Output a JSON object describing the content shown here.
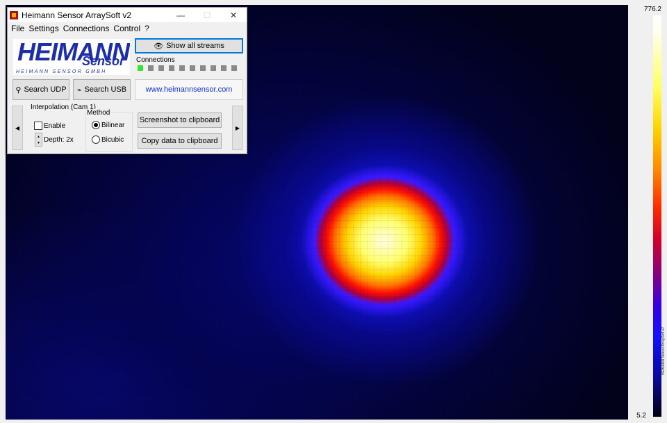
{
  "window": {
    "title": "Heimann Sensor ArraySoft v2",
    "controls": {
      "minimize": "—",
      "maximize": "☐",
      "close": "✕"
    }
  },
  "menu": [
    "File",
    "Settings",
    "Connections",
    "Control",
    "?"
  ],
  "logo": {
    "main": "HEIMANN",
    "sub": "Sensor",
    "foot": "HEIMANN SENSOR GMBH"
  },
  "buttons": {
    "show_streams": "Show all streams",
    "search_udp": "Search UDP",
    "search_usb": "Search USB",
    "website": "www.heimannsensor.com",
    "screenshot": "Screenshot to clipboard",
    "copy_data": "Copy data to clipboard"
  },
  "connections": {
    "label": "Connections",
    "states": [
      true,
      false,
      false,
      false,
      false,
      false,
      false,
      false,
      false,
      false
    ]
  },
  "interpolation": {
    "group_label": "Interpolation (Cam 1)",
    "enable_label": "Enable",
    "enable_checked": false,
    "depth_label": "Depth: 2x",
    "method_label": "Method",
    "methods": [
      {
        "label": "Bilinear",
        "selected": true
      },
      {
        "label": "Bicubic",
        "selected": false
      }
    ]
  },
  "nav": {
    "prev": "◀",
    "next": "▶"
  },
  "scale": {
    "max": "776.2",
    "min": "5.2",
    "vertical_caption": "HEIMANN Sensor ArraySoft v2"
  },
  "icons": {
    "eye": "eye-icon",
    "search": "search-icon",
    "usb": "usb-icon",
    "arrow_up": "arrow-up-icon",
    "arrow_down": "arrow-down-icon"
  },
  "colors": {
    "accent": "#0078d7",
    "logo": "#1d2ea8",
    "connected": "#2ee82e",
    "disconnected": "#8a8a8a",
    "link": "#1030d0"
  }
}
